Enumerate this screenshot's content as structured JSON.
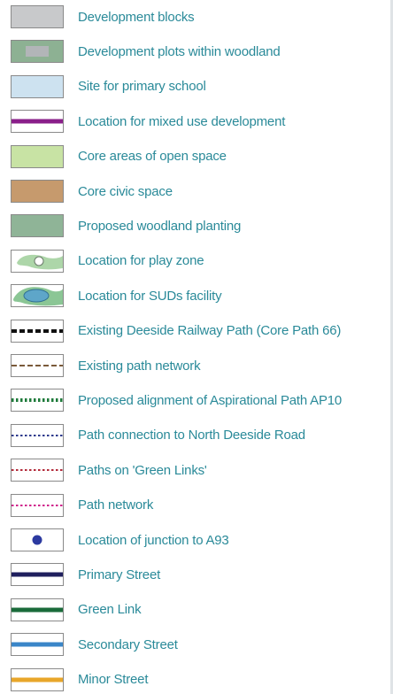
{
  "legend": {
    "items": [
      {
        "label": "Development blocks",
        "symbol": "fill",
        "fill": "#c8c9cb"
      },
      {
        "label": "Development plots within woodland",
        "symbol": "woodland-plot",
        "fill": "#8db193",
        "inner": "#b2b5b8"
      },
      {
        "label": "Site for primary school",
        "symbol": "fill",
        "fill": "#cde2f0"
      },
      {
        "label": "Location for mixed use development",
        "symbol": "line",
        "color": "#8a1f8a"
      },
      {
        "label": "Core areas of open space",
        "symbol": "fill",
        "fill": "#c8e3a4"
      },
      {
        "label": "Core civic space",
        "symbol": "fill",
        "fill": "#c69a6d"
      },
      {
        "label": "Proposed woodland planting",
        "symbol": "fill",
        "fill": "#8fb497"
      },
      {
        "label": "Location for play zone",
        "symbol": "play-icon",
        "fill": "#9fcf9a"
      },
      {
        "label": "Location for SUDs facility",
        "symbol": "suds-icon",
        "fill": "#5ea6c9"
      },
      {
        "label": "Existing Deeside Railway Path (Core Path 66)",
        "symbol": "dash",
        "color": "#111111",
        "weight": 4
      },
      {
        "label": "Existing path network",
        "symbol": "dash",
        "color": "#7a5a3a",
        "weight": 2
      },
      {
        "label": "Proposed alignment of Aspirational Path AP10",
        "symbol": "dot",
        "color": "#1e7a3a",
        "weight": 4
      },
      {
        "label": "Path connection to North Deeside Road",
        "symbol": "dot",
        "color": "#2d3a8c",
        "weight": 2
      },
      {
        "label": "Paths on 'Green Links'",
        "symbol": "dot",
        "color": "#b22a3a",
        "weight": 2
      },
      {
        "label": "Path network",
        "symbol": "dot",
        "color": "#d0238c",
        "weight": 2
      },
      {
        "label": "Location of junction to A93",
        "symbol": "circle",
        "color": "#2c3aa0"
      },
      {
        "label": "Primary Street",
        "symbol": "line",
        "color": "#1f1f5e"
      },
      {
        "label": "Green Link",
        "symbol": "line",
        "color": "#1a6b3a"
      },
      {
        "label": "Secondary Street",
        "symbol": "line",
        "color": "#3a86c8"
      },
      {
        "label": "Minor Street",
        "symbol": "line",
        "color": "#e8a62a"
      }
    ]
  }
}
